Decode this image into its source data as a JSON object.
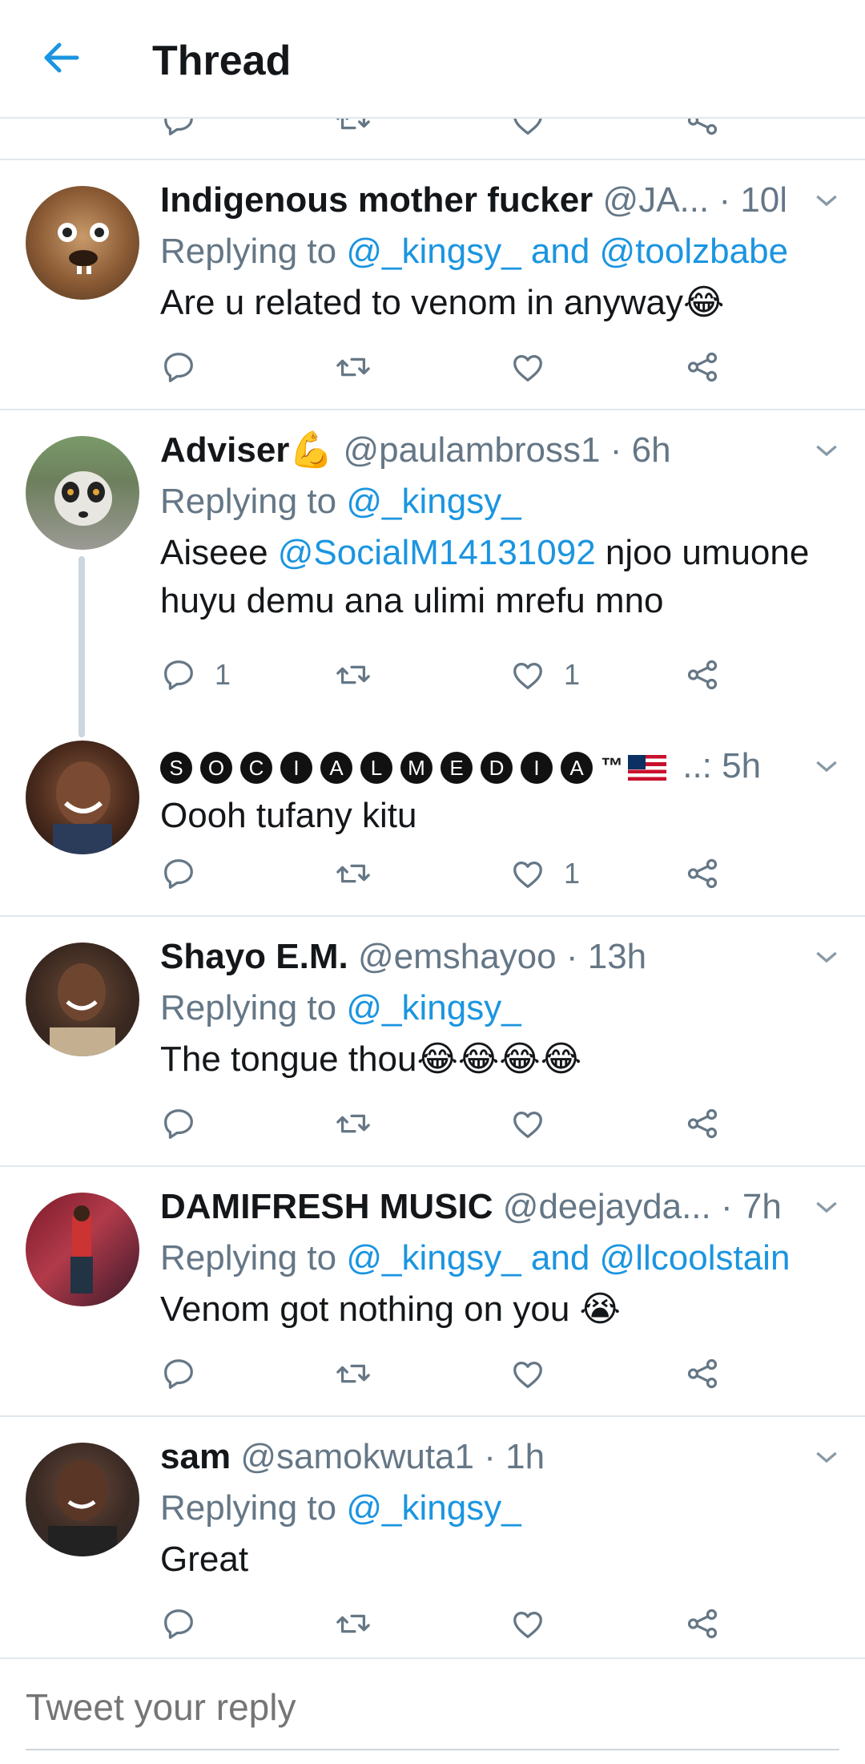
{
  "header": {
    "title": "Thread"
  },
  "tweets": [
    {
      "name": "Indigenous mother fucker",
      "handle": "@JA...",
      "time": "· 10h",
      "replying_prefix": "Replying to ",
      "replying_to": "@_kingsy_ and @toolzbabe",
      "text": "Are u related to venom in anyway",
      "emoji": "😂"
    },
    {
      "name": "Adviser",
      "name_emoji": "💪",
      "handle": "@paulambross1",
      "time": "· 6h",
      "replying_prefix": "Replying to ",
      "replying_to": "@_kingsy_",
      "text_pre": "Aiseee ",
      "mention": "@SocialM14131092",
      "text_post": " njoo umuone huyu demu ana ulimi mrefu mno",
      "reply_count": "1",
      "like_count": "1"
    },
    {
      "name_letters": [
        "S",
        "O",
        "C",
        "I",
        "A",
        "L",
        "M",
        "E",
        "D",
        "I",
        "A"
      ],
      "name_suffix": "™",
      "handle": "..:",
      "time": "5h",
      "text": "Oooh tufany kitu",
      "like_count": "1"
    },
    {
      "name": "Shayo E.M.",
      "handle": "@emshayoo",
      "time": "· 13h",
      "replying_prefix": "Replying to ",
      "replying_to": "@_kingsy_",
      "text": "The tongue thou",
      "emoji": "😂😂😂😂"
    },
    {
      "name": "DAMIFRESH MUSIC",
      "handle": "@deejayda...",
      "time": "· 7h",
      "replying_prefix": "Replying to ",
      "replying_to": "@_kingsy_ and @llcoolstain",
      "text": "Venom got nothing on you ",
      "emoji": "😭"
    },
    {
      "name": "sam",
      "handle": "@samokwuta1",
      "time": "· 1h",
      "replying_prefix": "Replying to ",
      "replying_to": "@_kingsy_",
      "text": "Great"
    }
  ],
  "reply_box": {
    "placeholder": "Tweet your reply"
  },
  "colors": {
    "accent": "#1b95e0",
    "muted": "#657786",
    "divider": "#e1e8ed"
  },
  "icons": [
    "back-arrow-icon",
    "reply-icon",
    "retweet-icon",
    "like-icon",
    "share-icon",
    "chevron-down-icon"
  ]
}
